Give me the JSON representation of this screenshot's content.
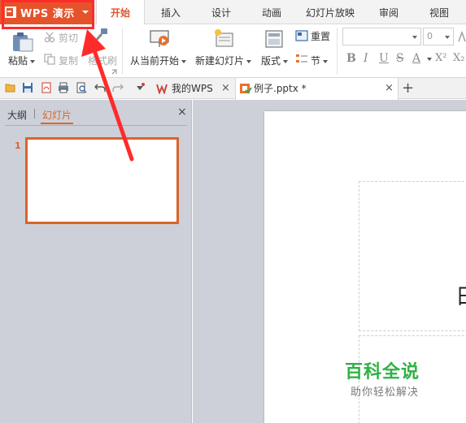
{
  "app": {
    "name": "WPS 演示",
    "accent_color": "#e5532b"
  },
  "menu": {
    "tabs": [
      "开始",
      "插入",
      "设计",
      "动画",
      "幻灯片放映",
      "审阅",
      "视图"
    ],
    "active_tab": "开始"
  },
  "ribbon": {
    "paste_label": "粘贴",
    "cut_label": "剪切",
    "copy_label": "复制",
    "format_painter_label": "格式刷",
    "from_current_label": "从当前开始",
    "new_slide_label": "新建幻灯片",
    "layout_label": "版式",
    "reset_label": "重置",
    "section_label": "节",
    "font_size_value": "0",
    "format_buttons": [
      "B",
      "I",
      "U",
      "S",
      "A",
      "X²",
      "X₂"
    ]
  },
  "tabbar": {
    "quick_access_icons": [
      "folder-open-icon",
      "save-icon",
      "export-pdf-icon",
      "print-icon",
      "print-preview-icon",
      "undo-icon",
      "redo-icon",
      "customize-icon"
    ],
    "tabs": [
      {
        "label": "我的WPS",
        "icon": "wps-logo-icon"
      },
      {
        "label": "例子.pptx *",
        "icon": "pptx-file-icon"
      }
    ],
    "close_glyph": "×",
    "new_tab_glyph": "+"
  },
  "left_pane": {
    "tabs": [
      "大纲",
      "幻灯片"
    ],
    "active_tab": "幻灯片",
    "close_glyph": "×",
    "slide_number": "1"
  },
  "slide": {
    "visible_text_fragment": "日"
  },
  "watermark": {
    "title": "百科全说",
    "subtitle": "助你轻松解决",
    "title_color": "#2fb144"
  },
  "annotation": {
    "highlight_color": "#ff2b2b"
  }
}
